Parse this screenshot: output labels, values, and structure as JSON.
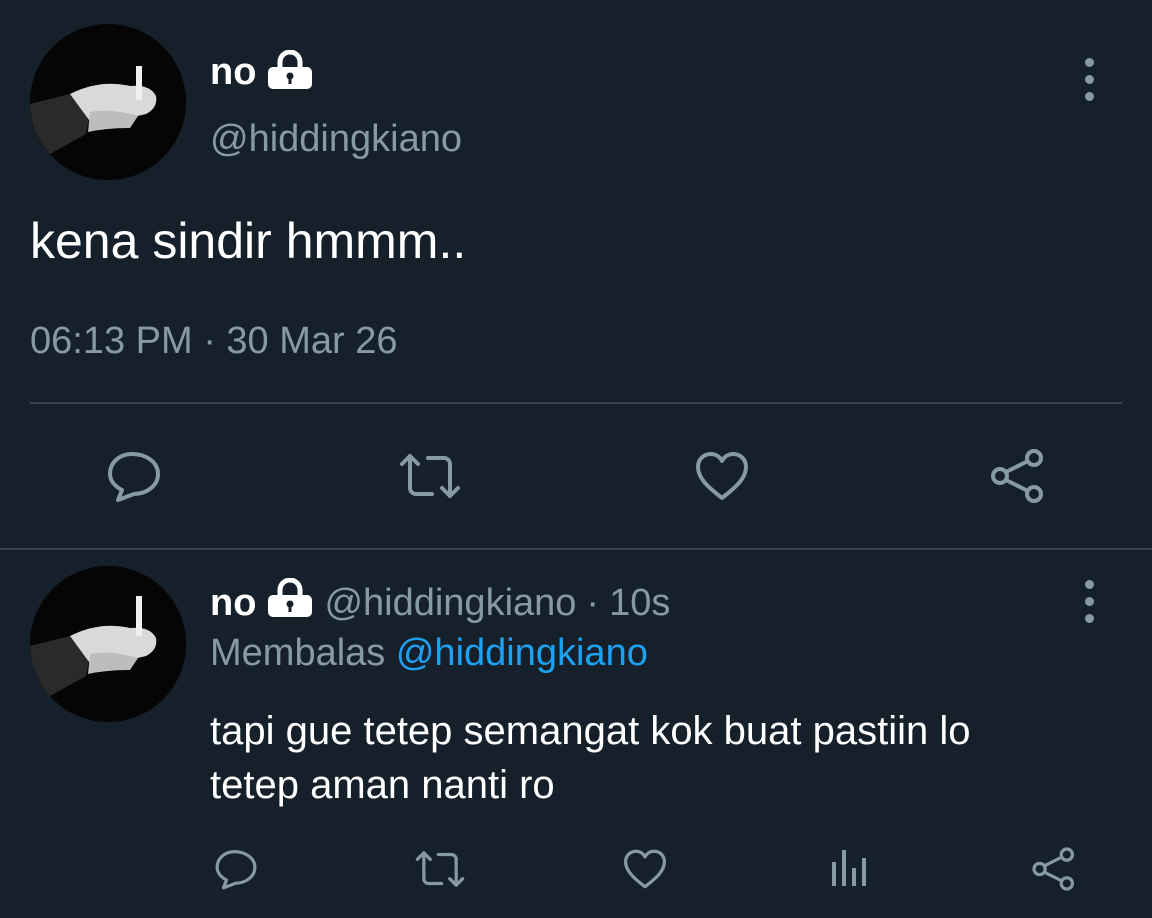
{
  "tweet": {
    "author": {
      "display_name": "no",
      "handle": "@hiddingkiano",
      "protected": true
    },
    "text": "kena sindir hmmm..",
    "timestamp": "06:13 PM · 30 Mar 26",
    "actions": [
      "reply-icon",
      "retweet-icon",
      "like-icon",
      "share-icon"
    ]
  },
  "reply": {
    "author": {
      "display_name": "no",
      "handle": "@hiddingkiano",
      "protected": true
    },
    "time_sep": "·",
    "age": "10s",
    "replying_to_label": "Membalas",
    "replying_to_handle": "@hiddingkiano",
    "text_line1": "tapi gue tetep semangat kok buat pastiin lo",
    "text_line2": "tetep aman nanti ro",
    "actions": [
      "reply-icon",
      "retweet-icon",
      "like-icon",
      "analytics-icon",
      "share-icon"
    ]
  },
  "colors": {
    "background": "#15202b",
    "text": "#ffffff",
    "secondary_text": "#8899a6",
    "link": "#1da1f2",
    "divider": "#38444d"
  }
}
